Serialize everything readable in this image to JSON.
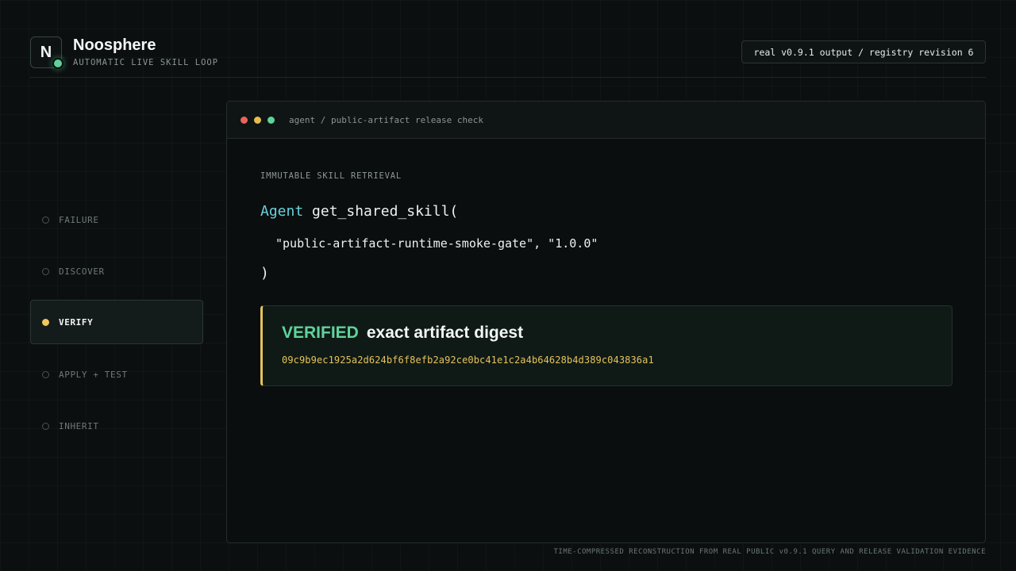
{
  "brand": {
    "logo_letter": "N",
    "name": "Noosphere",
    "subtitle": "AUTOMATIC LIVE SKILL LOOP",
    "status_color": "#5fd39a"
  },
  "version_badge": "real v0.9.1 output / registry revision 6",
  "steps": [
    {
      "label": "FAILURE",
      "active": false
    },
    {
      "label": "DISCOVER",
      "active": false
    },
    {
      "label": "VERIFY",
      "active": true
    },
    {
      "label": "APPLY + TEST",
      "active": false
    },
    {
      "label": "INHERIT",
      "active": false
    }
  ],
  "window": {
    "title": "agent / public-artifact release check",
    "section_label": "IMMUTABLE SKILL RETRIEVAL",
    "code": {
      "keyword": "Agent",
      "call": "get_shared_skill(",
      "args": "\"public-artifact-runtime-smoke-gate\", \"1.0.0\"",
      "close": ")"
    },
    "result": {
      "status": "VERIFIED",
      "message": "exact artifact digest",
      "digest": "09c9b9ec1925a2d624bf6f8efb2a92ce0bc41e1c2a4b64628b4d389c043836a1"
    }
  },
  "footer": "TIME-COMPRESSED RECONSTRUCTION FROM REAL PUBLIC v0.9.1 QUERY AND RELEASE VALIDATION EVIDENCE",
  "colors": {
    "accent_green": "#5fd39a",
    "accent_yellow": "#e6c25a",
    "keyword_cyan": "#6ad0dc",
    "background": "#0b0f0f"
  }
}
